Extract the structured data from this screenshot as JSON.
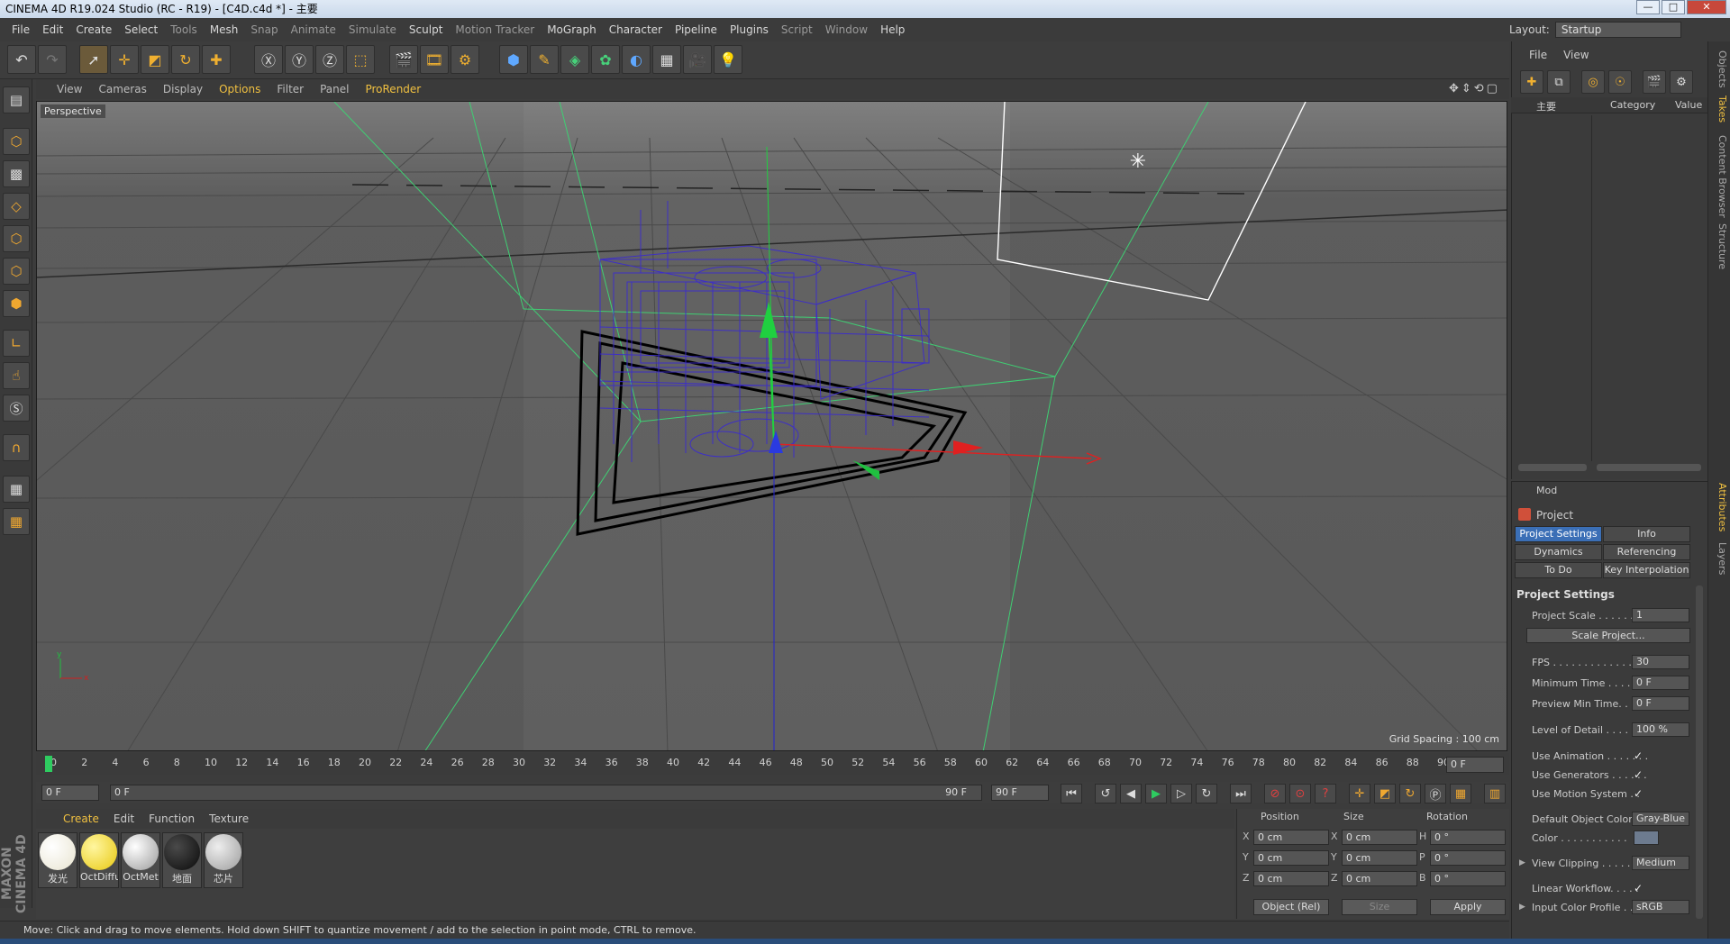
{
  "window": {
    "title": "CINEMA 4D R19.024 Studio (RC - R19) - [C4D.c4d *] - 主要",
    "buttons": {
      "minimize": "—",
      "maximize": "□",
      "close": "✕"
    }
  },
  "menu": [
    "File",
    "Edit",
    "Create",
    "Select",
    "Tools",
    "Mesh",
    "Snap",
    "Animate",
    "Simulate",
    "Sculpt",
    "Motion Tracker",
    "MoGraph",
    "Character",
    "Pipeline",
    "Plugins",
    "Script",
    "Window",
    "Help"
  ],
  "layout": {
    "label": "Layout:",
    "value": "Startup"
  },
  "viewport_menu": [
    "View",
    "Cameras",
    "Display",
    "Options",
    "Filter",
    "Panel",
    "ProRender"
  ],
  "viewport": {
    "label": "Perspective",
    "grid_spacing": "Grid Spacing : 100 cm"
  },
  "timeline": {
    "ticks": [
      "0",
      "2",
      "4",
      "6",
      "8",
      "10",
      "12",
      "14",
      "16",
      "18",
      "20",
      "22",
      "24",
      "26",
      "28",
      "30",
      "32",
      "34",
      "36",
      "38",
      "40",
      "42",
      "44",
      "46",
      "48",
      "50",
      "52",
      "54",
      "56",
      "58",
      "60",
      "62",
      "64",
      "66",
      "68",
      "70",
      "72",
      "74",
      "76",
      "78",
      "80",
      "82",
      "84",
      "86",
      "88",
      "90"
    ],
    "current_frame": "0 F",
    "start": "0 F",
    "range_start": "0 F",
    "range_end": "90 F",
    "end": "90 F"
  },
  "material_menu": [
    "Create",
    "Edit",
    "Function",
    "Texture"
  ],
  "materials": [
    {
      "name": "发光",
      "color": "#f4f1e4"
    },
    {
      "name": "OctDiffu",
      "color": "#f1d62c"
    },
    {
      "name": "OctMet",
      "color": "#d9d9d9"
    },
    {
      "name": "地面",
      "color": "#1d1d1d"
    },
    {
      "name": "芯片",
      "color": "#c4c4c4"
    }
  ],
  "coords": {
    "headers": {
      "position": "Position",
      "size": "Size",
      "rotation": "Rotation"
    },
    "rows": [
      {
        "axis": "X",
        "pos": "0 cm",
        "saxis": "X",
        "size": "0 cm",
        "raxis": "H",
        "rot": "0 °"
      },
      {
        "axis": "Y",
        "pos": "0 cm",
        "saxis": "Y",
        "size": "0 cm",
        "raxis": "P",
        "rot": "0 °"
      },
      {
        "axis": "Z",
        "pos": "0 cm",
        "saxis": "Z",
        "size": "0 cm",
        "raxis": "B",
        "rot": "0 °"
      }
    ],
    "mode": "Object (Rel)",
    "size_mode": "Size",
    "apply": "Apply"
  },
  "status": "Move: Click and drag to move elements. Hold down SHIFT to quantize movement / add to the selection in point mode, CTRL to remove.",
  "brand": "MAXON CINEMA 4D",
  "objects_panel": {
    "menu": [
      "File",
      "View"
    ],
    "columns": {
      "name": "主要",
      "category": "Category",
      "value": "Value"
    }
  },
  "attributes": {
    "menu": "Mod",
    "object": "Project",
    "tabs": [
      "Project Settings",
      "Info",
      "Dynamics",
      "Referencing",
      "To Do",
      "Key Interpolation"
    ],
    "section": "Project Settings",
    "rows": [
      {
        "label": "Project Scale . . . . . . .",
        "value": "1"
      },
      {
        "label": "FPS . . . . . . . . . . . . . . .",
        "value": "30"
      },
      {
        "label": "Minimum Time . . . . .",
        "value": "0 F"
      },
      {
        "label": "Preview Min Time. . . .",
        "value": "0 F"
      },
      {
        "label": "Level of Detail . . . . . .",
        "value": "100 %"
      }
    ],
    "scale_button": "Scale Project...",
    "checks": [
      {
        "label": "Use Animation . . . . . . .",
        "value": "✓"
      },
      {
        "label": "Use Generators . . . . . .",
        "value": "✓"
      },
      {
        "label": "Use Motion System . .",
        "value": "✓"
      }
    ],
    "default_color_label": "Default Object Color",
    "default_color_value": "Gray-Blue",
    "color_label": "Color . . . . . . . . . . .",
    "view_clipping_label": "View Clipping . . . . . . .",
    "view_clipping_value": "Medium",
    "linear_label": "Linear Workflow. . . . .",
    "linear_value": "✓",
    "input_profile_label": "Input Color Profile . . .",
    "input_profile_value": "sRGB"
  },
  "right_tabs": [
    "Objects",
    "Takes",
    "Content Browser",
    "Structure",
    "Attributes",
    "Layers"
  ]
}
